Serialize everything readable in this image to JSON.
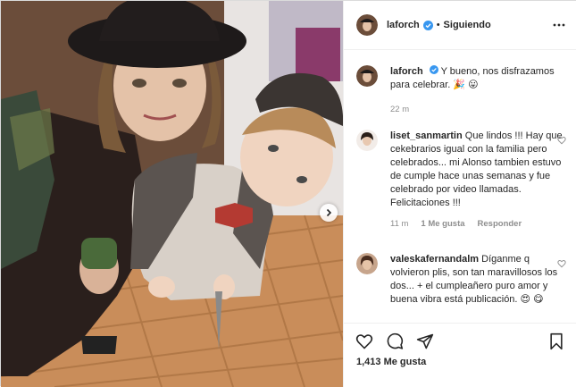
{
  "post": {
    "author": "laforch",
    "follow_status": "Siguiendo",
    "separator": "•",
    "caption": "Y bueno, nos disfrazamos para celebrar. 🎉 😛",
    "caption_time": "22 m",
    "likes_text": "1,413 Me gusta"
  },
  "comments": [
    {
      "user": "liset_sanmartin",
      "text": "Que lindos !!! Hay que cekebrarios igual con la familia pero celebrados... mi Alonso tambien estuvo de cumple hace unas semanas y fue celebrado por video llamadas. Felicitaciones !!!",
      "time": "11 m",
      "likes": "1 Me gusta",
      "reply": "Responder"
    },
    {
      "user": "valeskafernandalm",
      "text": "Díganme q volvieron plis, son tan maravillosos los dos... + el cumpleañero puro amor y buena vibra está publicación. 😍 😋"
    }
  ],
  "colors": {
    "verified": "#3897f0",
    "text": "#262626",
    "muted": "#8e8e8e",
    "border": "#efefef"
  },
  "icons": [
    "chevron-right-icon",
    "verified-icon",
    "more-options-icon",
    "heart-icon",
    "comment-icon",
    "share-icon",
    "bookmark-icon"
  ]
}
